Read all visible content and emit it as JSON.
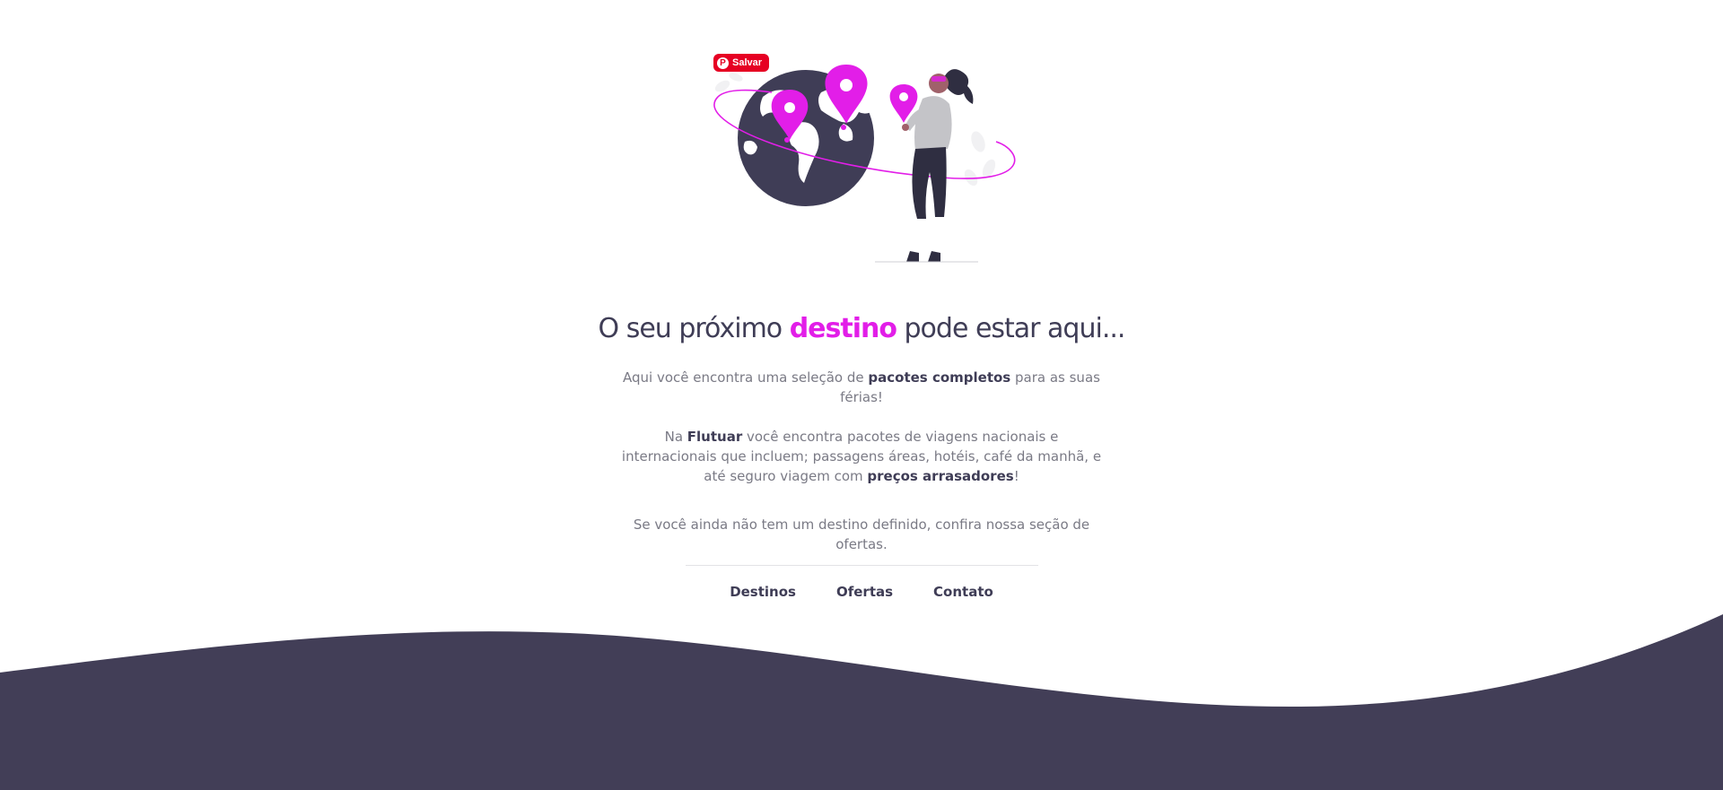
{
  "pinterest": {
    "save_label": "Salvar",
    "logo_glyph": "P",
    "color": "#e60023"
  },
  "headline": {
    "before": "O seu próximo ",
    "accent": "destino",
    "after": " pode estar aqui..."
  },
  "intro": {
    "before": "Aqui você encontra uma seleção de ",
    "strong": "pacotes completos",
    "after": " para as suas férias!"
  },
  "details": {
    "part1": "Na ",
    "brand": "Flutuar",
    "part2": " você encontra pacotes de viagens nacionais e internacionais que incluem; passagens áreas, hotéis, café da manhã, e até seguro viagem com ",
    "strong": "preços arrasadores",
    "part3": "!"
  },
  "offer_note": "Se você ainda não tem um destino definido, confira nossa seção de ofertas.",
  "footer_nav": {
    "destinos": "Destinos",
    "ofertas": "Ofertas",
    "contato": "Contato"
  },
  "colors": {
    "accent": "#e21ee8",
    "dark": "#3f3d56",
    "text": "#7a7a85",
    "wave": "#423e57"
  },
  "icons": [
    "pinterest-icon",
    "globe-icon",
    "map-pin-icon",
    "woman-traveler-figure",
    "leaf-icon"
  ]
}
